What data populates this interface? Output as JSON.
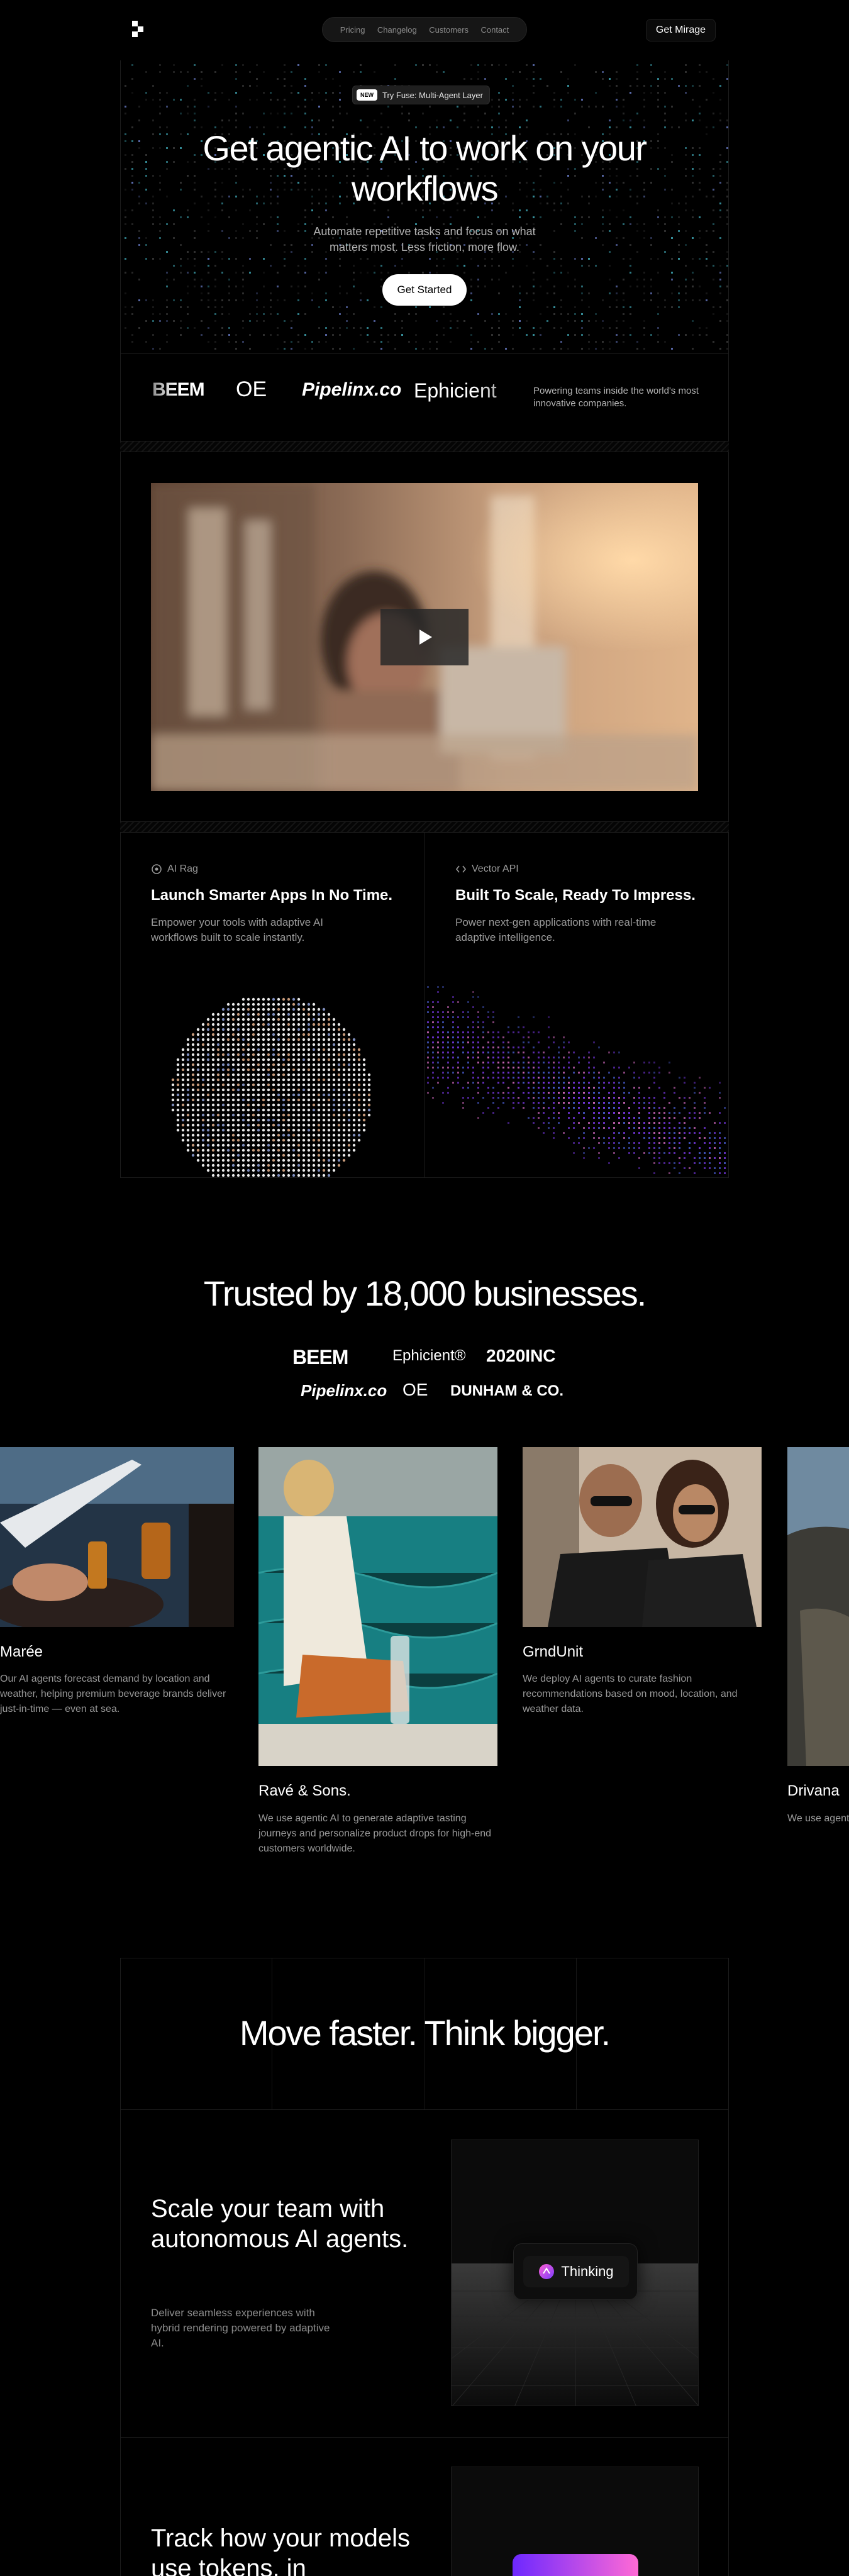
{
  "nav": {
    "links": [
      "Pricing",
      "Changelog",
      "Customers",
      "Contact"
    ],
    "cta": "Get Mirage"
  },
  "hero": {
    "badge_new": "NEW",
    "badge_text": "Try Fuse: Multi-Agent Layer",
    "title": "Get agentic AI to work on your workflows",
    "subtitle": "Automate repetitive tasks and focus on what matters most. Less friction, more flow.",
    "button": "Get Started"
  },
  "logos": {
    "brands": [
      "BEEM",
      "OE",
      "Pipelinx.co",
      "Ephicient"
    ],
    "caption": "Powering teams inside the world's most innovative companies."
  },
  "features": [
    {
      "tag": "AI Rag",
      "title": "Launch Smarter Apps In No Time.",
      "desc": "Empower your tools with adaptive AI workflows built to scale instantly."
    },
    {
      "tag": "Vector API",
      "title": "Built To Scale, Ready To Impress.",
      "desc": "Power next-gen applications with real-time adaptive intelligence."
    }
  ],
  "trusted": {
    "title": "Trusted by 18,000 businesses.",
    "row1": [
      "BEEM",
      "Ephicient®",
      "2020INC"
    ],
    "row2": [
      "Pipelinx.co",
      "OE",
      "DUNHAM & CO."
    ]
  },
  "carousel": [
    {
      "name": "Marée",
      "quote": "Our AI agents forecast demand by location and weather, helping premium beverage brands deliver just-in-time — even at sea."
    },
    {
      "name": "Ravé & Sons.",
      "quote": "We use agentic AI to generate adaptive tasting journeys and personalize product drops for high-end customers worldwide."
    },
    {
      "name": "GrndUnit",
      "quote": "We deploy AI agents to curate fashion recommendations based on mood, location, and weather data."
    },
    {
      "name": "Drivana",
      "quote": "We use agentic AI to personalize every experience — automation."
    }
  ],
  "move": {
    "title": "Move faster. Think bigger."
  },
  "sections": [
    {
      "title": "Scale your team with autonomous AI agents.",
      "desc": "Deliver seamless experiences with hybrid rendering powered by adaptive AI.",
      "pill": "Thinking"
    },
    {
      "title": "Track how your models use tokens, in"
    }
  ],
  "colors": {
    "bg": "#000000",
    "accent": "#8b5cf6",
    "text_muted": "#9a9a9a"
  }
}
